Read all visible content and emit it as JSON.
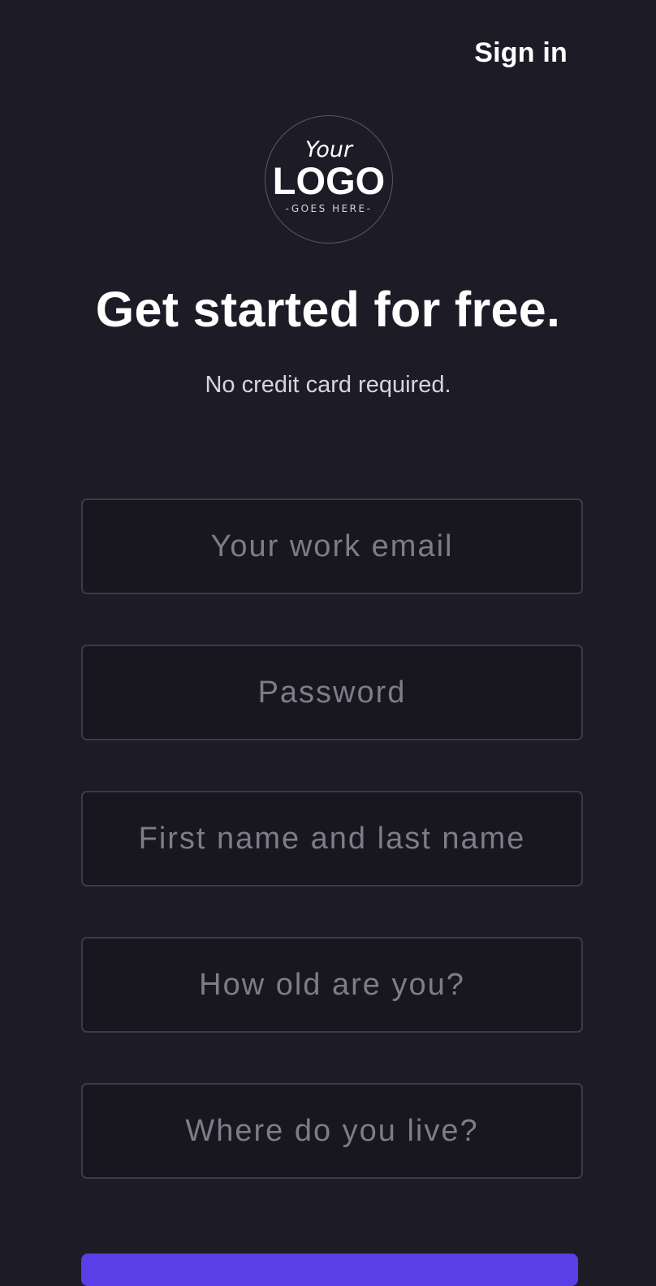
{
  "header": {
    "sign_in_label": "Sign in"
  },
  "logo": {
    "line1": "Your",
    "line2": "LOGO",
    "line3": "-GOES HERE-"
  },
  "hero": {
    "title": "Get started for free.",
    "subtitle": "No credit card required."
  },
  "form": {
    "email_placeholder": "Your work email",
    "password_placeholder": "Password",
    "name_placeholder": "First name and last name",
    "age_placeholder": "How old are you?",
    "location_placeholder": "Where do you live?"
  },
  "colors": {
    "background": "#1d1b26",
    "field_background": "#18161f",
    "field_border": "#3d3b47",
    "accent": "#5b3fe6"
  }
}
